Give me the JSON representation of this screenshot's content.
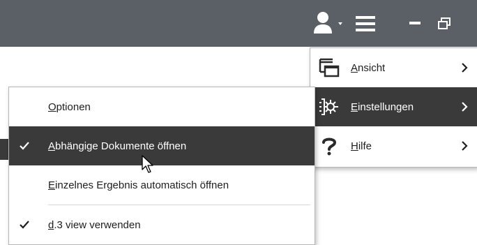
{
  "titlebar": {
    "bg_color": "#5b5f66",
    "icons": [
      "user-icon",
      "dropdown-caret-icon",
      "hamburger-menu-icon",
      "minimize-icon",
      "restore-window-icon"
    ]
  },
  "main_menu": {
    "items": [
      {
        "mnemonic": "A",
        "rest": "nsicht",
        "icon": "view-windows-icon",
        "has_submenu": true,
        "highlighted": false
      },
      {
        "mnemonic": "E",
        "rest": "instellungen",
        "icon": "settings-gear-icon",
        "has_submenu": true,
        "highlighted": true
      },
      {
        "mnemonic": "H",
        "rest": "ilfe",
        "icon": "help-question-icon",
        "has_submenu": true,
        "highlighted": false
      }
    ]
  },
  "sub_menu": {
    "items": [
      {
        "mnemonic": "O",
        "rest": "ptionen",
        "checked": false,
        "highlighted": false
      },
      {
        "mnemonic": "A",
        "rest": "bhängige Dokumente öffnen",
        "checked": true,
        "highlighted": true
      },
      {
        "mnemonic": "E",
        "rest": "inzelnes Ergebnis automatisch öffnen",
        "checked": false,
        "highlighted": false
      },
      {
        "mnemonic": "d",
        "rest": ".3 view verwenden",
        "checked": true,
        "highlighted": false
      }
    ]
  },
  "colors": {
    "highlight_bg": "#3a3a3a",
    "highlight_fg": "#ffffff",
    "menu_bg": "#ffffff"
  }
}
